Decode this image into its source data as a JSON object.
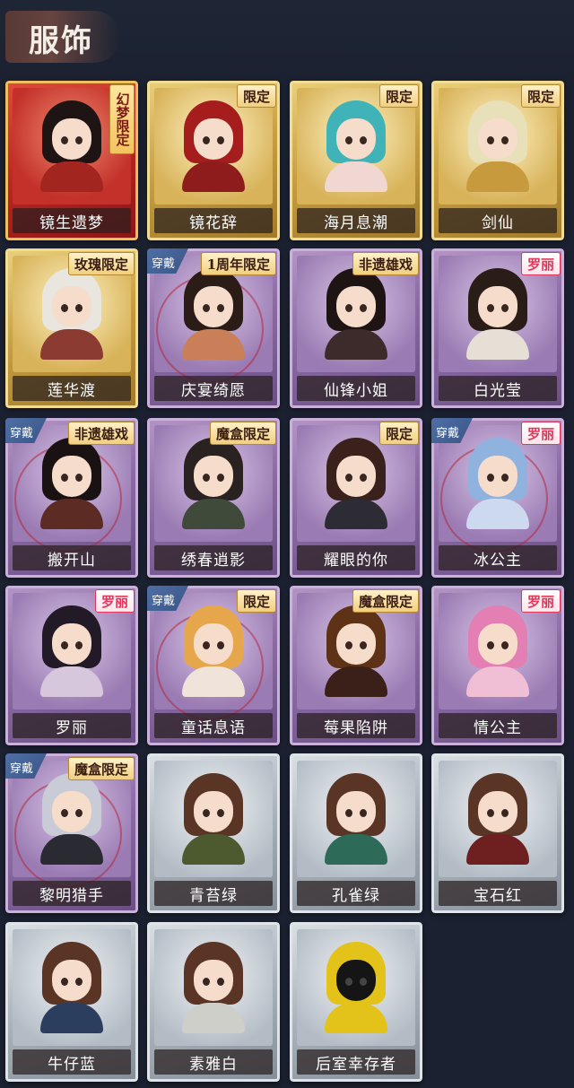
{
  "header": {
    "title": "服饰"
  },
  "labels": {
    "equipped": "穿戴"
  },
  "costumes": [
    {
      "name": "镜生遗梦",
      "rarity": "red",
      "badge": "幻梦限定",
      "badge_style": "vertical",
      "equipped": false,
      "hair": "#1f1414",
      "body": "#a32520"
    },
    {
      "name": "镜花辞",
      "rarity": "gold",
      "badge": "限定",
      "badge_style": "gold",
      "equipped": false,
      "hair": "#a51d1d",
      "body": "#8f1c1c"
    },
    {
      "name": "海月息潮",
      "rarity": "gold",
      "badge": "限定",
      "badge_style": "gold",
      "equipped": false,
      "hair": "#3fb3b8",
      "body": "#f0d7d2"
    },
    {
      "name": "剑仙",
      "rarity": "gold",
      "badge": "限定",
      "badge_style": "gold",
      "equipped": false,
      "hair": "#e7e0b8",
      "body": "#c79a3d"
    },
    {
      "name": "莲华渡",
      "rarity": "gold",
      "badge": "玫瑰限定",
      "badge_style": "gold",
      "equipped": false,
      "hair": "#e8e6df",
      "body": "#8b3b32"
    },
    {
      "name": "庆宴绮愿",
      "rarity": "purple",
      "badge": "1周年限定",
      "badge_style": "gold",
      "equipped": true,
      "hair": "#2c1c18",
      "body": "#c97f58"
    },
    {
      "name": "仙锋小姐",
      "rarity": "purple",
      "badge": "非遗雄戏",
      "badge_style": "gold",
      "equipped": false,
      "hair": "#1e1414",
      "body": "#3d2a2a"
    },
    {
      "name": "白光莹",
      "rarity": "purple",
      "badge": "罗丽",
      "badge_style": "pink",
      "equipped": false,
      "hair": "#2a1d17",
      "body": "#e6dfd6"
    },
    {
      "name": "搬开山",
      "rarity": "purple",
      "badge": "非遗雄戏",
      "badge_style": "gold",
      "equipped": true,
      "hair": "#1a1212",
      "body": "#5b2b24"
    },
    {
      "name": "绣春逍影",
      "rarity": "purple",
      "badge": "魔盒限定",
      "badge_style": "gold",
      "equipped": false,
      "hair": "#2a2220",
      "body": "#3f4a3a"
    },
    {
      "name": "耀眼的你",
      "rarity": "purple",
      "badge": "限定",
      "badge_style": "gold",
      "equipped": false,
      "hair": "#3a211b",
      "body": "#2d2b33"
    },
    {
      "name": "冰公主",
      "rarity": "purple",
      "badge": "罗丽",
      "badge_style": "pink",
      "equipped": true,
      "hair": "#8fb2de",
      "body": "#cdd9ef"
    },
    {
      "name": "罗丽",
      "rarity": "purple",
      "badge": "罗丽",
      "badge_style": "pink",
      "equipped": false,
      "hair": "#231a28",
      "body": "#d6c7dc"
    },
    {
      "name": "童话息语",
      "rarity": "purple",
      "badge": "限定",
      "badge_style": "gold",
      "equipped": true,
      "hair": "#e5a64c",
      "body": "#f0e3da"
    },
    {
      "name": "莓果陷阱",
      "rarity": "purple",
      "badge": "魔盒限定",
      "badge_style": "gold",
      "equipped": false,
      "hair": "#5e3216",
      "body": "#3a2018"
    },
    {
      "name": "情公主",
      "rarity": "purple",
      "badge": "罗丽",
      "badge_style": "pink",
      "equipped": false,
      "hair": "#e37fb3",
      "body": "#f1bfd5"
    },
    {
      "name": "黎明猎手",
      "rarity": "purple",
      "badge": "魔盒限定",
      "badge_style": "gold",
      "equipped": true,
      "hair": "#c9ccd6",
      "body": "#2a2a33"
    },
    {
      "name": "青苔绿",
      "rarity": "grey",
      "badge": "",
      "badge_style": "",
      "equipped": false,
      "hair": "#5a3525",
      "body": "#4d5a2f"
    },
    {
      "name": "孔雀绿",
      "rarity": "grey",
      "badge": "",
      "badge_style": "",
      "equipped": false,
      "hair": "#5a3525",
      "body": "#2d6a57"
    },
    {
      "name": "宝石红",
      "rarity": "grey",
      "badge": "",
      "badge_style": "",
      "equipped": false,
      "hair": "#5a3525",
      "body": "#6e2020"
    },
    {
      "name": "牛仔蓝",
      "rarity": "grey",
      "badge": "",
      "badge_style": "",
      "equipped": false,
      "hair": "#5a3525",
      "body": "#2c3e5e"
    },
    {
      "name": "素雅白",
      "rarity": "grey",
      "badge": "",
      "badge_style": "",
      "equipped": false,
      "hair": "#5a3525",
      "body": "#cfcfc9"
    },
    {
      "name": "后室幸存者",
      "rarity": "grey",
      "badge": "",
      "badge_style": "",
      "equipped": false,
      "hair": "#e3c21a",
      "body": "#e3c21a"
    }
  ]
}
